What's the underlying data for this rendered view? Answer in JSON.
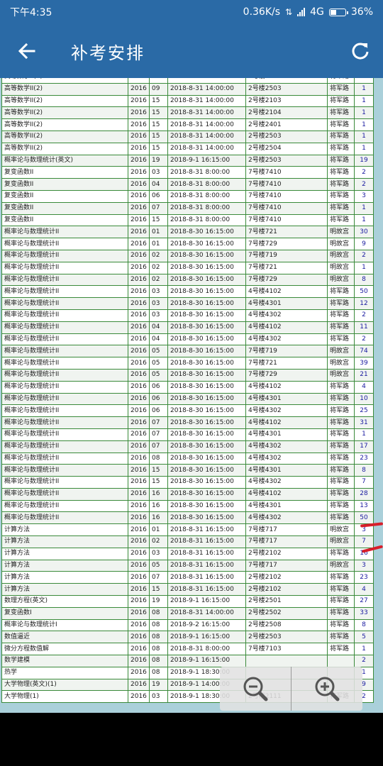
{
  "status_bar": {
    "time": "下午4:35",
    "speed": "0.36K/s",
    "network": "4G",
    "battery": "36%",
    "battery_level": 0.36
  },
  "app_bar": {
    "title": "补考安排",
    "back_icon": "arrow-left-icon",
    "refresh_icon": "refresh-icon"
  },
  "exam_table": {
    "rows": [
      [
        "高等数学II(2)",
        "2016",
        "09",
        "2018-8-31 14:00:00",
        "2号楼2501",
        "将军路",
        "1"
      ],
      [
        "高等数学II(2)",
        "2016",
        "09",
        "2018-8-31 14:00:00",
        "2号楼2503",
        "将军路",
        "1"
      ],
      [
        "高等数学II(2)",
        "2016",
        "15",
        "2018-8-31 14:00:00",
        "2号楼2103",
        "将军路",
        "1"
      ],
      [
        "高等数学II(2)",
        "2016",
        "15",
        "2018-8-31 14:00:00",
        "2号楼2104",
        "将军路",
        "1"
      ],
      [
        "高等数学II(2)",
        "2016",
        "15",
        "2018-8-31 14:00:00",
        "2号楼2401",
        "将军路",
        "1"
      ],
      [
        "高等数学II(2)",
        "2016",
        "15",
        "2018-8-31 14:00:00",
        "2号楼2503",
        "将军路",
        "1"
      ],
      [
        "高等数学II(2)",
        "2016",
        "15",
        "2018-8-31 14:00:00",
        "2号楼2504",
        "将军路",
        "1"
      ],
      [
        "概率论与数理统计(英文)",
        "2016",
        "19",
        "2018-9-1 16:15:00",
        "2号楼2503",
        "将军路",
        "19"
      ],
      [
        "复变函数II",
        "2016",
        "03",
        "2018-8-31 8:00:00",
        "7号楼7410",
        "将军路",
        "2"
      ],
      [
        "复变函数II",
        "2016",
        "04",
        "2018-8-31 8:00:00",
        "7号楼7410",
        "将军路",
        "2"
      ],
      [
        "复变函数II",
        "2016",
        "06",
        "2018-8-31 8:00:00",
        "7号楼7410",
        "将军路",
        "3"
      ],
      [
        "复变函数II",
        "2016",
        "07",
        "2018-8-31 8:00:00",
        "7号楼7410",
        "将军路",
        "1"
      ],
      [
        "复变函数II",
        "2016",
        "15",
        "2018-8-31 8:00:00",
        "7号楼7410",
        "将军路",
        "1"
      ],
      [
        "概率论与数理统计II",
        "2016",
        "01",
        "2018-8-30 16:15:00",
        "7号楼721",
        "明故宫",
        "30"
      ],
      [
        "概率论与数理统计II",
        "2016",
        "01",
        "2018-8-30 16:15:00",
        "7号楼729",
        "明故宫",
        "9"
      ],
      [
        "概率论与数理统计II",
        "2016",
        "02",
        "2018-8-30 16:15:00",
        "7号楼719",
        "明故宫",
        "2"
      ],
      [
        "概率论与数理统计II",
        "2016",
        "02",
        "2018-8-30 16:15:00",
        "7号楼721",
        "明故宫",
        "1"
      ],
      [
        "概率论与数理统计II",
        "2016",
        "02",
        "2018-8-30 16:15:00",
        "7号楼729",
        "明故宫",
        "8"
      ],
      [
        "概率论与数理统计II",
        "2016",
        "03",
        "2018-8-30 16:15:00",
        "4号楼4102",
        "将军路",
        "50"
      ],
      [
        "概率论与数理统计II",
        "2016",
        "03",
        "2018-8-30 16:15:00",
        "4号楼4301",
        "将军路",
        "12"
      ],
      [
        "概率论与数理统计II",
        "2016",
        "03",
        "2018-8-30 16:15:00",
        "4号楼4302",
        "将军路",
        "2"
      ],
      [
        "概率论与数理统计II",
        "2016",
        "04",
        "2018-8-30 16:15:00",
        "4号楼4102",
        "将军路",
        "11"
      ],
      [
        "概率论与数理统计II",
        "2016",
        "04",
        "2018-8-30 16:15:00",
        "4号楼4302",
        "将军路",
        "2"
      ],
      [
        "概率论与数理统计II",
        "2016",
        "05",
        "2018-8-30 16:15:00",
        "7号楼719",
        "明故宫",
        "74"
      ],
      [
        "概率论与数理统计II",
        "2016",
        "05",
        "2018-8-30 16:15:00",
        "7号楼721",
        "明故宫",
        "39"
      ],
      [
        "概率论与数理统计II",
        "2016",
        "05",
        "2018-8-30 16:15:00",
        "7号楼729",
        "明故宫",
        "21"
      ],
      [
        "概率论与数理统计II",
        "2016",
        "06",
        "2018-8-30 16:15:00",
        "4号楼4102",
        "将军路",
        "4"
      ],
      [
        "概率论与数理统计II",
        "2016",
        "06",
        "2018-8-30 16:15:00",
        "4号楼4301",
        "将军路",
        "10"
      ],
      [
        "概率论与数理统计II",
        "2016",
        "06",
        "2018-8-30 16:15:00",
        "4号楼4302",
        "将军路",
        "25"
      ],
      [
        "概率论与数理统计II",
        "2016",
        "07",
        "2018-8-30 16:15:00",
        "4号楼4102",
        "将军路",
        "31"
      ],
      [
        "概率论与数理统计II",
        "2016",
        "07",
        "2018-8-30 16:15:00",
        "4号楼4301",
        "将军路",
        "1"
      ],
      [
        "概率论与数理统计II",
        "2016",
        "07",
        "2018-8-30 16:15:00",
        "4号楼4302",
        "将军路",
        "17"
      ],
      [
        "概率论与数理统计II",
        "2016",
        "08",
        "2018-8-30 16:15:00",
        "4号楼4302",
        "将军路",
        "23"
      ],
      [
        "概率论与数理统计II",
        "2016",
        "15",
        "2018-8-30 16:15:00",
        "4号楼4301",
        "将军路",
        "8"
      ],
      [
        "概率论与数理统计II",
        "2016",
        "15",
        "2018-8-30 16:15:00",
        "4号楼4302",
        "将军路",
        "7"
      ],
      [
        "概率论与数理统计II",
        "2016",
        "16",
        "2018-8-30 16:15:00",
        "4号楼4102",
        "将军路",
        "28"
      ],
      [
        "概率论与数理统计II",
        "2016",
        "16",
        "2018-8-30 16:15:00",
        "4号楼4301",
        "将军路",
        "13"
      ],
      [
        "概率论与数理统计II",
        "2016",
        "16",
        "2018-8-30 16:15:00",
        "4号楼4302",
        "将军路",
        "50"
      ],
      [
        "计算方法",
        "2016",
        "01",
        "2018-8-31 16:15:00",
        "7号楼717",
        "明故宫",
        "3"
      ],
      [
        "计算方法",
        "2016",
        "02",
        "2018-8-31 16:15:00",
        "7号楼717",
        "明故宫",
        "7"
      ],
      [
        "计算方法",
        "2016",
        "03",
        "2018-8-31 16:15:00",
        "2号楼2102",
        "将军路",
        "16"
      ],
      [
        "计算方法",
        "2016",
        "05",
        "2018-8-31 16:15:00",
        "7号楼717",
        "明故宫",
        "3"
      ],
      [
        "计算方法",
        "2016",
        "07",
        "2018-8-31 16:15:00",
        "2号楼2102",
        "将军路",
        "23"
      ],
      [
        "计算方法",
        "2016",
        "15",
        "2018-8-31 16:15:00",
        "2号楼2102",
        "将军路",
        "4"
      ],
      [
        "数理方程(英文)",
        "2016",
        "19",
        "2018-9-1 16:15:00",
        "2号楼2501",
        "将军路",
        "27"
      ],
      [
        "复变函数I",
        "2016",
        "08",
        "2018-8-31 14:00:00",
        "2号楼2502",
        "将军路",
        "33"
      ],
      [
        "概率论与数理统计I",
        "2016",
        "08",
        "2018-9-2 16:15:00",
        "2号楼2508",
        "将军路",
        "8"
      ],
      [
        "数值逼近",
        "2016",
        "08",
        "2018-9-1 16:15:00",
        "2号楼2503",
        "将军路",
        "5"
      ],
      [
        "微分方程数值解",
        "2016",
        "08",
        "2018-8-31 8:00:00",
        "7号楼7103",
        "将军路",
        "1"
      ],
      [
        "数学建模",
        "2016",
        "08",
        "2018-9-1 16:15:00",
        "",
        "",
        "2"
      ],
      [
        "热学",
        "2016",
        "08",
        "2018-9-1 18:30:00",
        "",
        "",
        "1"
      ],
      [
        "大学物理(英文)(1)",
        "2016",
        "19",
        "2018-9-1 14:00:00",
        "",
        "",
        "9"
      ],
      [
        "大学物理(1)",
        "2016",
        "03",
        "2018-9-1 18:30:00",
        "2号楼2111",
        "将军路",
        "2"
      ]
    ]
  },
  "zoom_controls": {
    "zoom_out_icon": "zoom-out-icon",
    "zoom_in_icon": "zoom-in-icon"
  },
  "colors": {
    "app_bar": "#2a6aa6",
    "table_border": "#3a8a3a",
    "page_bg": "#aad0da",
    "annotation": "#d81e2a"
  }
}
